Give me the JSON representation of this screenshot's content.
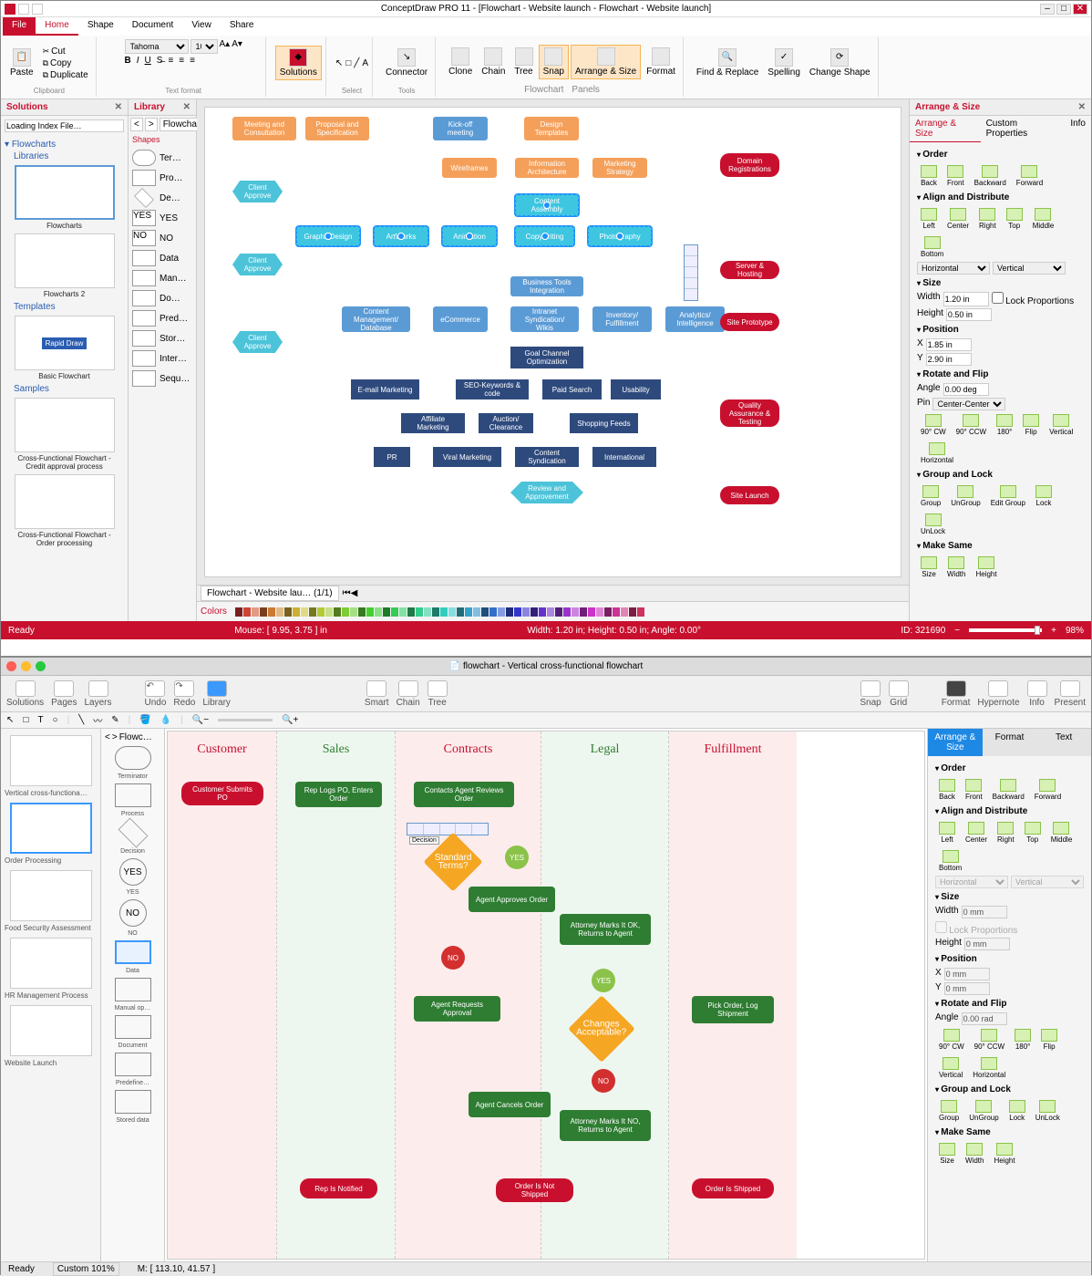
{
  "win1": {
    "title": "ConceptDraw PRO 11 - [Flowchart - Website launch - Flowchart - Website launch]",
    "menu": [
      "File",
      "Home",
      "Shape",
      "Document",
      "View",
      "Share"
    ],
    "ribbon": {
      "clipboard": {
        "paste": "Paste",
        "cut": "Cut",
        "copy": "Copy",
        "duplicate": "Duplicate",
        "label": "Clipboard"
      },
      "font": {
        "name": "Tahoma",
        "size": "10",
        "label": "Text format"
      },
      "solutions": {
        "label": "Solutions"
      },
      "select": {
        "label": "Select"
      },
      "tools": {
        "connector": "Connector",
        "label": "Tools"
      },
      "flowchart": {
        "clone": "Clone",
        "chain": "Chain",
        "tree": "Tree",
        "snap": "Snap",
        "arrange": "Arrange & Size",
        "format": "Format",
        "label": "Flowchart",
        "panels": "Panels"
      },
      "editing": {
        "find": "Find & Replace",
        "spelling": "Spelling",
        "change": "Change Shape"
      }
    },
    "solutions": {
      "title": "Solutions",
      "search": "Loading Index File…",
      "flowcharts": "Flowcharts",
      "libraries": "Libraries",
      "lib_items": [
        "Flowcharts",
        "Flowcharts 2"
      ],
      "templates": "Templates",
      "tmpl_items": [
        "Rapid Draw",
        "Basic Flowchart"
      ],
      "samples": "Samples",
      "sample_items": [
        "Cross-Functional Flowchart - Credit approval process",
        "Cross-Functional Flowchart - Order processing"
      ]
    },
    "library": {
      "title": "Library",
      "tab": "Flowchar…",
      "shapes_hd": "Shapes",
      "shapes": [
        "Ter…",
        "Pro…",
        "De…",
        "YES",
        "NO",
        "Data",
        "Man…",
        "Do…",
        "Pred…",
        "Stor…",
        "Inter…",
        "Sequ…"
      ]
    },
    "canvas_doc_tab": "Flowchart - Website lau…  (1/1)",
    "nodes": {
      "meeting": "Meeting and Consultation",
      "proposal": "Proposal and Specification",
      "kickoff": "Kick-off meeting",
      "design": "Design Templates",
      "wireframes": "Wireframes",
      "info": "Information Architecture",
      "marketing": "Marketing Strategy",
      "approve1": "Client Approve",
      "approve2": "Client Approve",
      "approve3": "Client Approve",
      "assembly": "Content Assembly",
      "graphic": "GraphicDesign",
      "art": "ArtWorks",
      "anim": "Animation",
      "copy": "Copywriting",
      "photo": "Photography",
      "biz": "Business Tools Integration",
      "cm": "Content Management/ Database",
      "ecom": "eCommerce",
      "intranet": "Intranet Syndication/ Wikis",
      "inv": "Inventory/ Fulfillment",
      "analytics": "Analytics/ Intelligence",
      "goal": "Goal Channel Optimization",
      "email": "E-mail Marketing",
      "seo": "SEO-Keywords & code",
      "paid": "Paid Search",
      "use": "Usability",
      "aff": "Affiliate Marketing",
      "auction": "Auction/ Clearance",
      "shop": "Shopping Feeds",
      "pr": "PR",
      "viral": "Viral Marketing",
      "syn": "Content Syndication",
      "intl": "International",
      "review": "Review and Approvement",
      "domain": "Domain Registrations",
      "server": "Server & Hosting",
      "proto": "Site Prototype",
      "qa": "Quality Assurance & Testing",
      "launch": "Site Launch"
    },
    "colors_label": "Colors",
    "rpanel": {
      "title": "Arrange & Size",
      "tabs": [
        "Arrange & Size",
        "Custom Properties",
        "Info"
      ],
      "order": {
        "hd": "Order",
        "btns": [
          "Back",
          "Front",
          "Backward",
          "Forward"
        ]
      },
      "align": {
        "hd": "Align and Distribute",
        "btns": [
          "Left",
          "Center",
          "Right",
          "Top",
          "Middle",
          "Bottom"
        ],
        "horiz": "Horizontal",
        "vert": "Vertical"
      },
      "size": {
        "hd": "Size",
        "width": "Width",
        "wval": "1.20 in",
        "height": "Height",
        "hval": "0.50 in",
        "lock": "Lock Proportions"
      },
      "position": {
        "hd": "Position",
        "x": "X",
        "xval": "1.85 in",
        "y": "Y",
        "yval": "2.90 in"
      },
      "rotate": {
        "hd": "Rotate and Flip",
        "angle": "Angle",
        "aval": "0.00 deg",
        "pin": "Pin",
        "pval": "Center-Center",
        "btns": [
          "90° CW",
          "90° CCW",
          "180°",
          "Flip",
          "Vertical",
          "Horizontal"
        ]
      },
      "group": {
        "hd": "Group and Lock",
        "btns": [
          "Group",
          "UnGroup",
          "Edit Group",
          "Lock",
          "UnLock"
        ]
      },
      "make": {
        "hd": "Make Same",
        "btns": [
          "Size",
          "Width",
          "Height"
        ]
      }
    },
    "status": {
      "ready": "Ready",
      "mouse": "Mouse: [ 9.95, 3.75 ] in",
      "dims": "Width: 1.20 in;  Height: 0.50 in;  Angle: 0.00°",
      "id": "ID: 321690",
      "zoom": "98%"
    }
  },
  "win2": {
    "title": "flowchart - Vertical cross-functional flowchart",
    "toolbar": {
      "solutions": "Solutions",
      "pages": "Pages",
      "layers": "Layers",
      "undo": "Undo",
      "redo": "Redo",
      "library": "Library",
      "smart": "Smart",
      "chain": "Chain",
      "tree": "Tree",
      "snap": "Snap",
      "grid": "Grid",
      "format": "Format",
      "hypernote": "Hypernote",
      "info": "Info",
      "present": "Present"
    },
    "lhs": {
      "items": [
        "Vertical cross-functiona…",
        "Order Processing",
        "Food Security Assessment",
        "HR Management Process",
        "Website Launch"
      ]
    },
    "lib": {
      "tab": "Flowc…",
      "shapes": [
        "Terminator",
        "Process",
        "Decision",
        "YES",
        "NO",
        "Data",
        "Manual op…",
        "Document",
        "Predefine…",
        "Stored data"
      ]
    },
    "lanes": [
      "Customer",
      "Sales",
      "Contracts",
      "Legal",
      "Fulfillment"
    ],
    "nodes": {
      "submit": "Customer Submits PO",
      "rep": "Rep Logs PO, Enters Order",
      "contacts": "Contacts Agent Reviews Order",
      "decision": "Decision",
      "std": "Standard Terms?",
      "yes1": "YES",
      "no1": "NO",
      "approves": "Agent Approves Order",
      "marksok": "Attorney Marks It OK, Returns to Agent",
      "yes2": "YES",
      "req": "Agent Requests Approval",
      "changes": "Changes Acceptable?",
      "no2": "NO",
      "pick": "Pick Order, Log Shipment",
      "cancels": "Agent Cancels Order",
      "marksno": "Attorney Marks It NO, Returns to Agent",
      "notified": "Rep Is Notified",
      "notship": "Order Is Not Shipped",
      "shipped": "Order Is Shipped"
    },
    "rhs": {
      "tabs": [
        "Arrange & Size",
        "Format",
        "Text"
      ],
      "order": {
        "hd": "Order",
        "btns": [
          "Back",
          "Front",
          "Backward",
          "Forward"
        ]
      },
      "align": {
        "hd": "Align and Distribute",
        "btns": [
          "Left",
          "Center",
          "Right",
          "Top",
          "Middle",
          "Bottom"
        ],
        "horiz": "Horizontal",
        "vert": "Vertical"
      },
      "size": {
        "hd": "Size",
        "width": "Width",
        "wval": "0 mm",
        "height": "Height",
        "hval": "0 mm",
        "lock": "Lock Proportions"
      },
      "position": {
        "hd": "Position",
        "x": "X",
        "xval": "0 mm",
        "y": "Y",
        "yval": "0 mm"
      },
      "rotate": {
        "hd": "Rotate and Flip",
        "angle": "Angle",
        "aval": "0.00 rad",
        "btns": [
          "90° CW",
          "90° CCW",
          "180°",
          "Flip",
          "Vertical",
          "Horizontal"
        ]
      },
      "group": {
        "hd": "Group and Lock",
        "btns": [
          "Group",
          "UnGroup",
          "Lock",
          "UnLock"
        ]
      },
      "make": {
        "hd": "Make Same",
        "btns": [
          "Size",
          "Width",
          "Height"
        ]
      }
    },
    "status": {
      "ready": "Ready",
      "custom": "Custom 101%",
      "mouse": "M: [ 113.10, 41.57 ]"
    }
  }
}
